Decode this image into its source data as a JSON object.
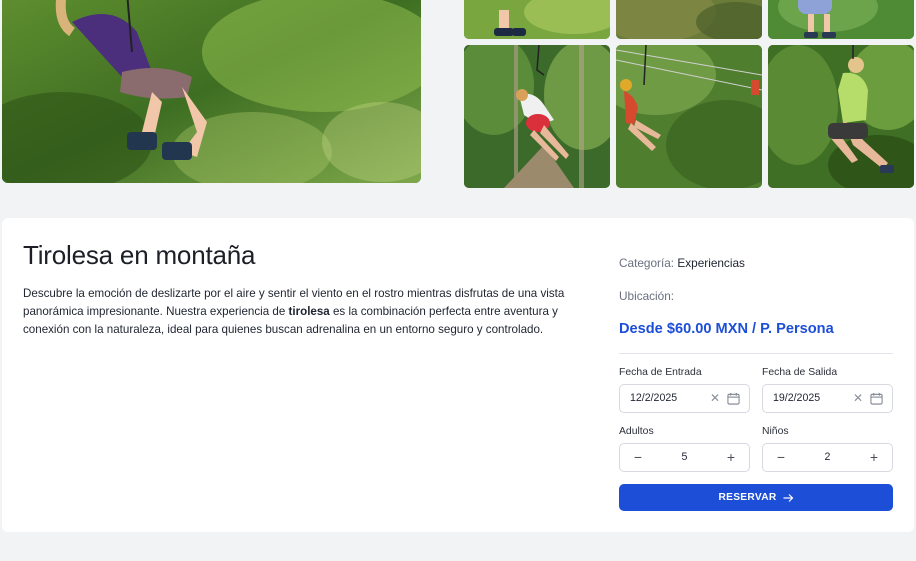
{
  "gallery": {
    "main_alt": "zipline-rider-main",
    "thumbs": [
      "zipline-thumb-1",
      "zipline-thumb-2",
      "zipline-thumb-3",
      "zipline-thumb-4",
      "zipline-thumb-5",
      "zipline-thumb-6"
    ]
  },
  "tour": {
    "title": "Tirolesa en montaña",
    "description_part1": "Descubre la emoción de deslizarte por el aire y sentir el viento en el rostro mientras disfrutas de una vista panorámica impresionante. Nuestra experiencia de ",
    "description_bold": "tirolesa",
    "description_part2": " es la combinación perfecta entre aventura y conexión con la naturaleza, ideal para quienes buscan adrenalina en un entorno seguro y controlado."
  },
  "booking": {
    "category_label": "Categoría:",
    "category_value": "Experiencias",
    "location_label": "Ubicación:",
    "price": "Desde $60.00 MXN / P. Persona",
    "checkin_label": "Fecha de Entrada",
    "checkin_value": "12/2/2025",
    "checkout_label": "Fecha de Salida",
    "checkout_value": "19/2/2025",
    "adults_label": "Adultos",
    "adults_value": "5",
    "kids_label": "Niños",
    "kids_value": "2",
    "reserve_label": "RESERVAR"
  },
  "colors": {
    "accent": "#1d4ed8",
    "background": "#f2f3f5",
    "card": "#ffffff"
  },
  "icons": {
    "clear": "close-icon",
    "calendar": "calendar-icon",
    "minus": "minus-icon",
    "plus": "plus-icon",
    "arrow": "arrow-right-icon"
  }
}
